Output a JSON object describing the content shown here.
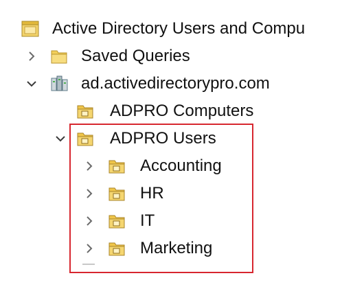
{
  "tree": {
    "root": {
      "label": "Active Directory Users and Compu",
      "icon": "console-folder-icon"
    },
    "saved_queries": {
      "label": "Saved Queries",
      "icon": "folder-icon",
      "expander": "chevron-right-icon"
    },
    "domain": {
      "label": "ad.activedirectorypro.com",
      "icon": "domain-icon",
      "expander": "chevron-down-icon"
    },
    "adpro_computers": {
      "label": "ADPRO Computers",
      "icon": "ou-folder-icon"
    },
    "adpro_users": {
      "label": "ADPRO Users",
      "icon": "ou-folder-icon",
      "expander": "chevron-down-icon",
      "children": [
        {
          "label": "Accounting",
          "icon": "ou-folder-icon",
          "expander": "chevron-right-icon"
        },
        {
          "label": "HR",
          "icon": "ou-folder-icon",
          "expander": "chevron-right-icon"
        },
        {
          "label": "IT",
          "icon": "ou-folder-icon",
          "expander": "chevron-right-icon"
        },
        {
          "label": "Marketing",
          "icon": "ou-folder-icon",
          "expander": "chevron-right-icon"
        }
      ]
    }
  },
  "colors": {
    "highlight_border": "#d7262e",
    "folder_yellow": "#f0c64a",
    "chevron": "#6b6b6b"
  }
}
